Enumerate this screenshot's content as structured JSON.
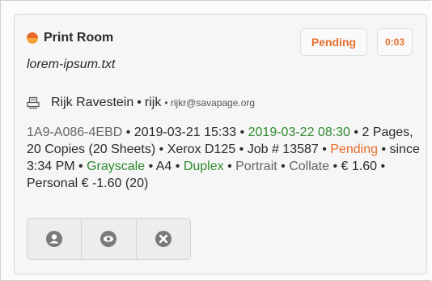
{
  "job": {
    "queue_name": "Print Room",
    "status_badge": "Pending",
    "time_badge": "0:03",
    "document_name": "lorem-ipsum.txt",
    "user_full_name": "Rijk Ravestein",
    "user_sep": "•",
    "user_id": "rijk",
    "user_email": "rijkr@savapage.org",
    "details": {
      "job_id": "1A9-A086-4EBD",
      "sep": " • ",
      "submitted": "2019-03-21 15:33",
      "expiry": "2019-03-22 08:30",
      "pages": "2 Pages, 20 Copies (20 Sheets)",
      "printer": "Xerox D125",
      "job_number": "Job # 13587",
      "status": "Pending",
      "since": "since 3:34 PM",
      "color_mode": "Grayscale",
      "paper": "A4",
      "duplex": "Duplex",
      "orientation": "Portrait",
      "collate": "Collate",
      "cost": "€ 1.60",
      "account": "Personal € -1.60 (20)"
    }
  },
  "actions": {
    "user_icon": "user-icon",
    "preview_icon": "eye-icon",
    "cancel_icon": "close-circle-icon"
  },
  "colors": {
    "accent_orange": "#e8702e",
    "green": "#2e8a2e",
    "icon_gray": "#7a7a7a"
  }
}
